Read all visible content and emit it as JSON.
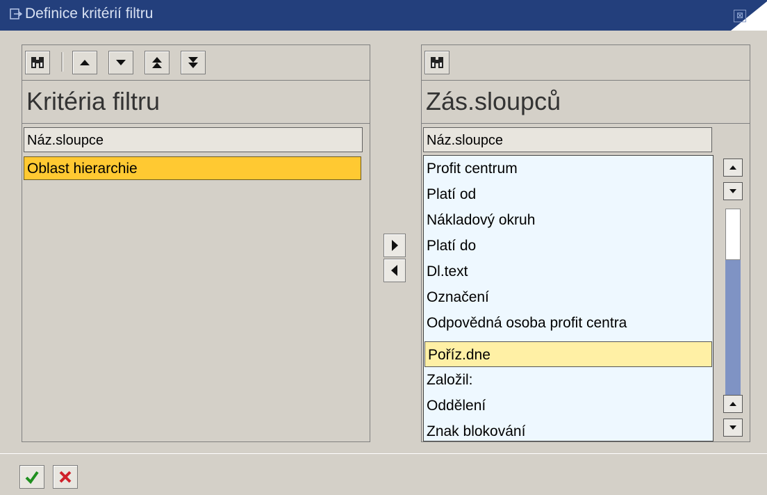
{
  "window": {
    "title": "Definice kritérií filtru",
    "close_label": "⊠"
  },
  "left_panel": {
    "heading": "Kritéria filtru",
    "column_header": "Náz.sloupce",
    "items": [
      "Oblast hierarchie"
    ],
    "toolbar_icons": [
      "find-icon",
      "move-up-icon",
      "move-down-icon",
      "move-top-icon",
      "move-bottom-icon"
    ]
  },
  "right_panel": {
    "heading": "Zás.sloupců",
    "column_header": "Náz.sloupce",
    "items": [
      "Profit centrum",
      "Platí od",
      "Nákladový okruh",
      "Platí do",
      "Dl.text",
      "Označení",
      "Odpovědná osoba profit centra",
      "Poříz.dne",
      "Založil:",
      "Oddělení",
      "Znak blokování"
    ],
    "selected_index": 7,
    "toolbar_icons": [
      "find-icon"
    ]
  },
  "transfer_buttons": [
    "arrow-right-icon",
    "arrow-left-icon"
  ],
  "footer_buttons": [
    "confirm-icon",
    "cancel-icon"
  ]
}
